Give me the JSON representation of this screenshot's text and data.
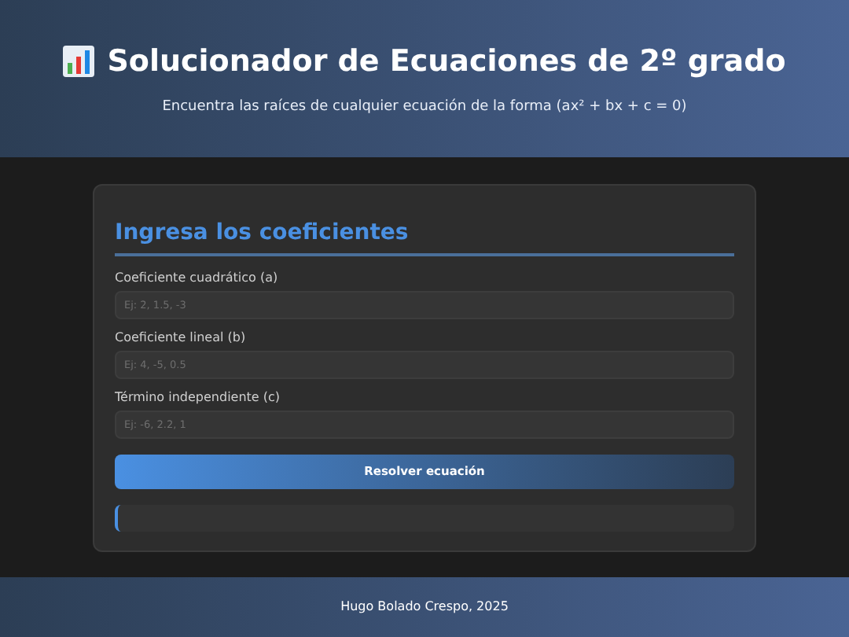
{
  "header": {
    "title": "Solucionador de Ecuaciones de 2º grado",
    "subtitle": "Encuentra las raíces de cualquier ecuación de la forma (ax² + bx + c = 0)"
  },
  "form": {
    "heading": "Ingresa los coeficientes",
    "fields": [
      {
        "label": "Coeficiente cuadrático (a)",
        "placeholder": "Ej: 2, 1.5, -3"
      },
      {
        "label": "Coeficiente lineal (b)",
        "placeholder": "Ej: 4, -5, 0.5"
      },
      {
        "label": "Término independiente (c)",
        "placeholder": "Ej: -6, 2.2, 1"
      }
    ],
    "button": "Resolver ecuación"
  },
  "footer": "Hugo Bolado Crespo, 2025"
}
